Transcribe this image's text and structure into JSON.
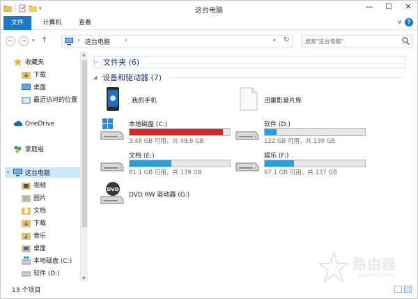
{
  "window": {
    "title": "这台电脑",
    "accent": "#1979ca"
  },
  "ribbon": {
    "tabs": [
      {
        "label": "文件",
        "active": true
      },
      {
        "label": "计算机",
        "active": false
      },
      {
        "label": "查看",
        "active": false
      }
    ],
    "help_label": "?"
  },
  "address": {
    "crumb": "这台电脑",
    "sep": "›",
    "search_placeholder": "搜索\"这台电脑\""
  },
  "nav": {
    "favorites": {
      "label": "收藏夹",
      "items": [
        "下载",
        "桌面",
        "最近访问的位置"
      ]
    },
    "onedrive": "OneDrive",
    "homegroup": "家庭组",
    "thispc": {
      "label": "这台电脑",
      "items": [
        "视频",
        "图片",
        "文档",
        "下载",
        "音乐",
        "桌面",
        "本地磁盘 (C:)",
        "软件 (D:)"
      ]
    }
  },
  "content": {
    "folders_group": "文件夹 (6)",
    "devices_group": "设备和驱动器 (7)",
    "devices": [
      {
        "name": "我的手机",
        "type": "phone"
      },
      {
        "name": "迅雷影音片库",
        "type": "doc"
      },
      {
        "name": "本地磁盘 (C:)",
        "type": "drive-win",
        "info": "3.48 GB 可用，共 49.6 GB",
        "used": 0.93,
        "bar_color": "#da2626"
      },
      {
        "name": "软件 (D:)",
        "type": "drive",
        "info": "122 GB 可用，共 139 GB",
        "used": 0.12,
        "bar_color": "#26a0da"
      },
      {
        "name": "文档 (E:)",
        "type": "drive",
        "info": "81.1 GB 可用，共 139 GB",
        "used": 0.42,
        "bar_color": "#26a0da"
      },
      {
        "name": "娱乐 (F:)",
        "type": "drive",
        "info": "97.1 GB 可用，共 137 GB",
        "used": 0.29,
        "bar_color": "#26a0da"
      },
      {
        "name": "DVD RW 驱动器 (G:)",
        "type": "dvd"
      }
    ]
  },
  "status": {
    "count": "13 个项目"
  },
  "watermark": {
    "text": "路由器",
    "url": "www.lotpc.com"
  }
}
